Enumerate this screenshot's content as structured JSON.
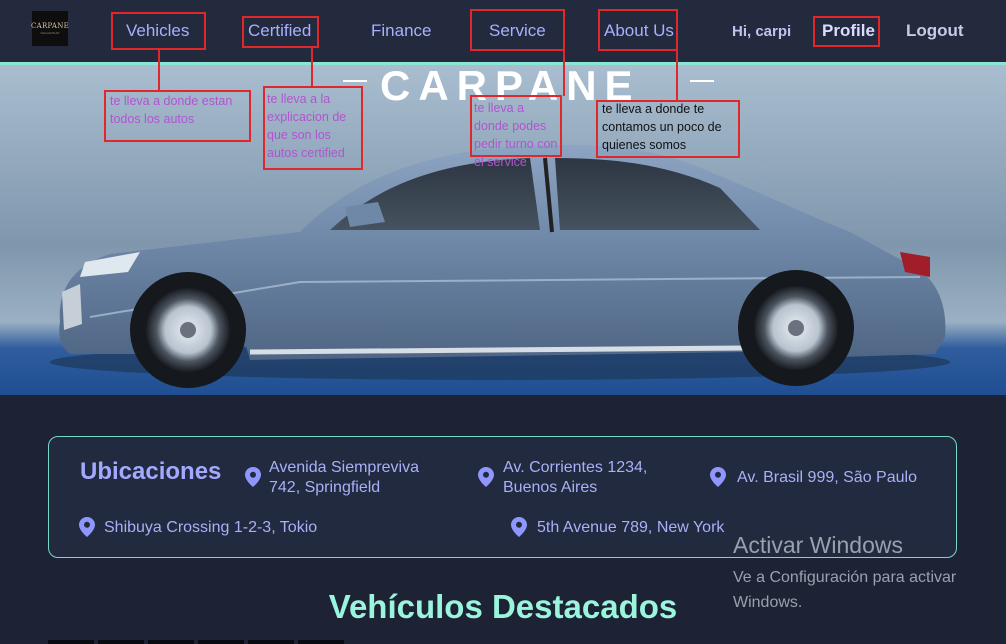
{
  "nav": {
    "logo_text": "CARPANE",
    "logo_sub": "DEALERSHIP",
    "links": [
      {
        "label": "Vehicles"
      },
      {
        "label": "Certified"
      },
      {
        "label": "Finance"
      },
      {
        "label": "Service"
      },
      {
        "label": "About Us"
      }
    ],
    "greeting": "Hi, carpi",
    "profile": "Profile",
    "logout": "Logout"
  },
  "annotations": {
    "vehicles": "te lleva a donde estan todos los autos",
    "certified": "te lleva a la explicacion de que son los autos certified",
    "service": "te lleva a donde podes pedir turno con el service",
    "about": "te lleva a donde te contamos un poco de quienes somos"
  },
  "hero": {
    "brand": "CARPANE"
  },
  "locations": {
    "title": "Ubicaciones",
    "items": [
      "Avenida Siempreviva 742, Springfield",
      "Av. Corrientes 1234, Buenos Aires",
      "Av. Brasil 999, São Paulo",
      "Shibuya Crossing 1-2-3, Tokio",
      "5th Avenue 789, New York"
    ]
  },
  "featured": {
    "title": "Vehículos Destacados"
  },
  "windows": {
    "title": "Activar Windows",
    "subtitle": "Ve a Configuración para activar Windows."
  },
  "colors": {
    "background": "#1d2234",
    "nav": "#232a3e",
    "accent_text": "#a7b0ff",
    "teal": "#9af5dc",
    "annotation_red": "#e0282b"
  }
}
